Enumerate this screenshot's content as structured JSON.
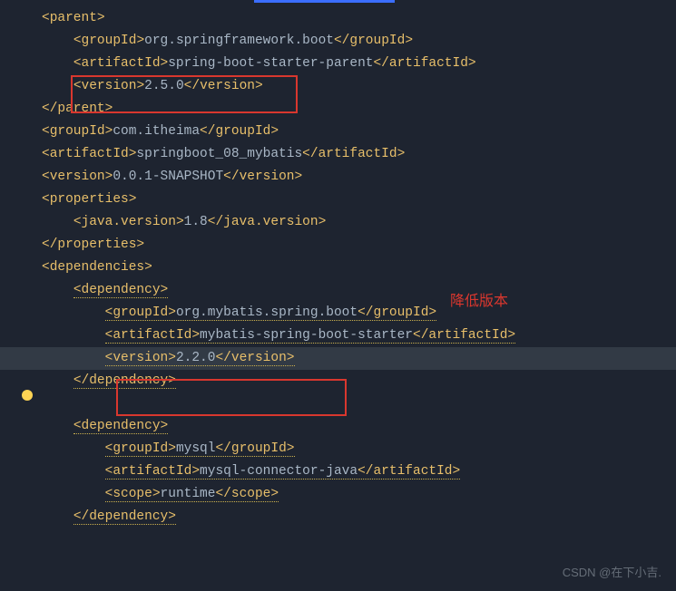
{
  "annotation": "降低版本",
  "watermark": "CSDN @在下小吉.",
  "pom": {
    "parent": {
      "groupId": "org.springframework.boot",
      "artifactId": "spring-boot-starter-parent",
      "version": "2.5.0"
    },
    "groupId": "com.itheima",
    "artifactId": "springboot_08_mybatis",
    "version": "0.0.1-SNAPSHOT",
    "properties": {
      "javaVersion": "1.8"
    },
    "dependencies": [
      {
        "groupId": "org.mybatis.spring.boot",
        "artifactId": "mybatis-spring-boot-starter",
        "version": "2.2.0"
      },
      {
        "groupId": "mysql",
        "artifactId": "mysql-connector-java",
        "scope": "runtime"
      }
    ]
  },
  "tags": {
    "parent": "parent",
    "groupId": "groupId",
    "artifactId": "artifactId",
    "version": "version",
    "properties": "properties",
    "javaVersion": "java.version",
    "dependencies": "dependencies",
    "dependency": "dependency",
    "scope": "scope"
  }
}
